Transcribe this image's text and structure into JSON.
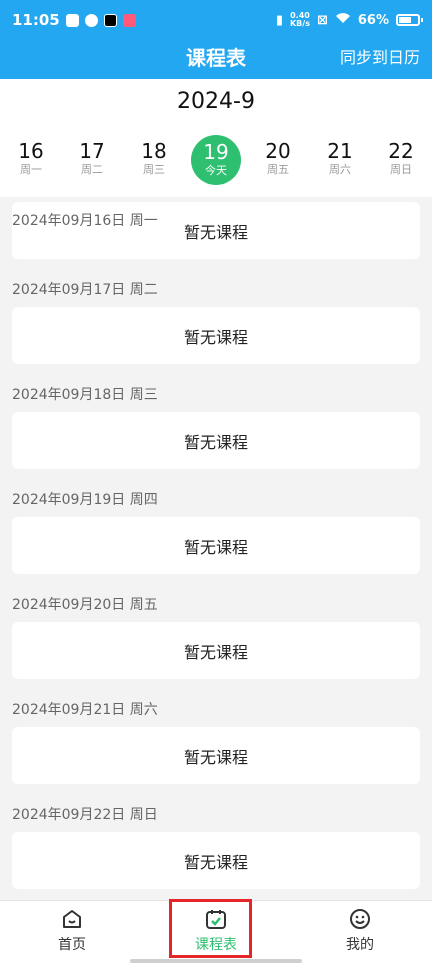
{
  "status": {
    "time": "11:05",
    "net_value": "0.40",
    "net_unit": "KB/s",
    "battery": "66%"
  },
  "header": {
    "title": "课程表",
    "sync_button": "同步到日历"
  },
  "calendar": {
    "month": "2024-9",
    "days": [
      {
        "num": "16",
        "label": "周一"
      },
      {
        "num": "17",
        "label": "周二"
      },
      {
        "num": "18",
        "label": "周三"
      },
      {
        "num": "19",
        "label": "今天"
      },
      {
        "num": "20",
        "label": "周五"
      },
      {
        "num": "21",
        "label": "周六"
      },
      {
        "num": "22",
        "label": "周日"
      }
    ]
  },
  "schedule": [
    {
      "date": "2024年09月16日 周一",
      "status": "暂无课程"
    },
    {
      "date": "2024年09月17日 周二",
      "status": "暂无课程"
    },
    {
      "date": "2024年09月18日 周三",
      "status": "暂无课程"
    },
    {
      "date": "2024年09月19日 周四",
      "status": "暂无课程"
    },
    {
      "date": "2024年09月20日 周五",
      "status": "暂无课程"
    },
    {
      "date": "2024年09月21日 周六",
      "status": "暂无课程"
    },
    {
      "date": "2024年09月22日 周日",
      "status": "暂无课程"
    }
  ],
  "nav": {
    "home": "首页",
    "schedule": "课程表",
    "mine": "我的"
  },
  "colors": {
    "header": "#22a7f0",
    "accent": "#2fbf71",
    "highlight": "#e5252a"
  }
}
